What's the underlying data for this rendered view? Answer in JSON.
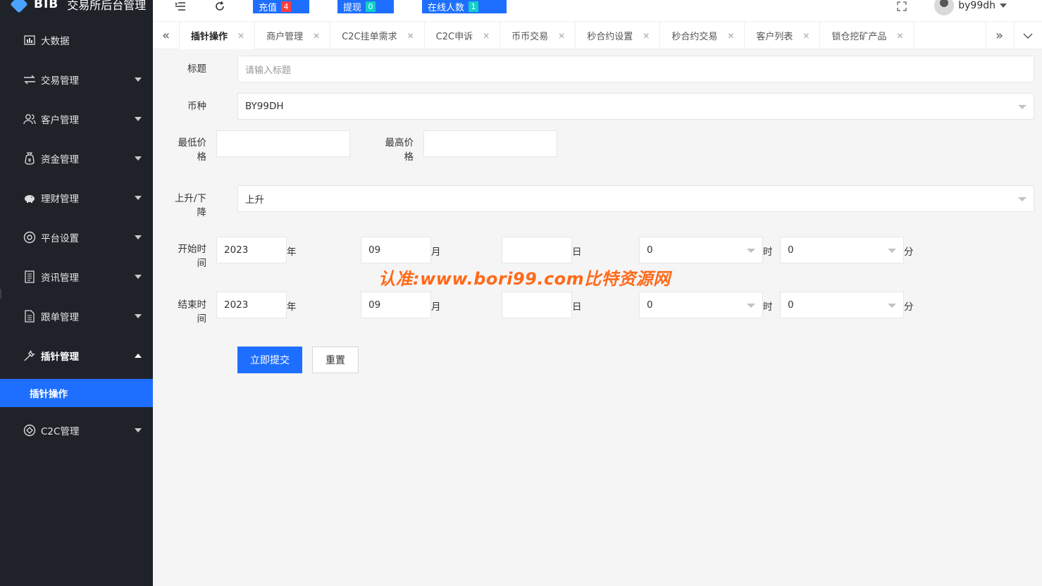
{
  "app": {
    "brand": "BIB",
    "title": "交易所后台管理"
  },
  "sidebar": {
    "items": [
      {
        "label": "大数据",
        "icon": "chart-icon"
      },
      {
        "label": "交易管理",
        "icon": "exchange-icon"
      },
      {
        "label": "客户管理",
        "icon": "users-icon"
      },
      {
        "label": "资金管理",
        "icon": "moneybag-icon"
      },
      {
        "label": "理财管理",
        "icon": "piggy-icon"
      },
      {
        "label": "平台设置",
        "icon": "settings-icon"
      },
      {
        "label": "资讯管理",
        "icon": "news-icon"
      },
      {
        "label": "跟单管理",
        "icon": "document-icon"
      },
      {
        "label": "插针管理",
        "icon": "wrench-icon"
      },
      {
        "label": "C2C管理",
        "icon": "coin-icon"
      }
    ],
    "sub_active": "插针操作"
  },
  "header": {
    "recharge_label": "充值",
    "recharge_count": "4",
    "withdraw_label": "提现",
    "withdraw_count": "0",
    "online_label": "在线人数",
    "online_count": "1",
    "username": "by99dh"
  },
  "tabs": [
    "插针操作",
    "商户管理",
    "C2C挂单需求",
    "C2C申诉",
    "币币交易",
    "秒合约设置",
    "秒合约交易",
    "客户列表",
    "锁仓挖矿产品"
  ],
  "form": {
    "title_label": "标题",
    "title_placeholder": "请输入标题",
    "coin_label": "币种",
    "coin_value": "BY99DH",
    "min_price_label": "最低价格",
    "max_price_label": "最高价格",
    "direction_label": "上升/下降",
    "direction_value": "上升",
    "start_label": "开始时间",
    "end_label": "结束时间",
    "start": {
      "year": "2023",
      "month": "09",
      "day": "",
      "hour": "0",
      "minute": "0"
    },
    "end": {
      "year": "2023",
      "month": "09",
      "day": "",
      "hour": "0",
      "minute": "0"
    },
    "unit_year": "年",
    "unit_month": "月",
    "unit_day": "日",
    "unit_hour": "时",
    "unit_minute": "分",
    "submit_label": "立即提交",
    "reset_label": "重置"
  },
  "watermark": "认准:www.bori99.com比特资源网"
}
